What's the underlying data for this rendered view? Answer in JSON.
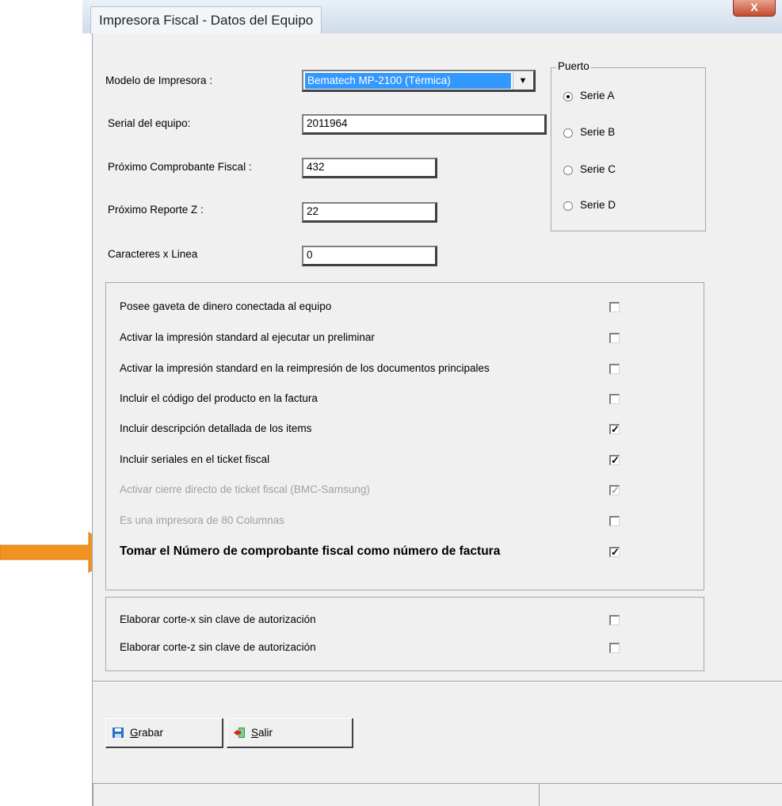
{
  "window": {
    "title": "Impresora Fiscal - Datos del Equipo",
    "close_label": "X"
  },
  "form": {
    "modelo_label": "Modelo  de Impresora :",
    "modelo_value": "Bematech MP-2100 (Térmica)",
    "serial_label": "Serial del equipo:",
    "serial_value": "2011964",
    "comprobante_label": "Próximo Comprobante Fiscal :",
    "comprobante_value": "432",
    "reporte_label": "Próximo Reporte Z :",
    "reporte_value": "22",
    "caracteres_label": "Caracteres x Linea",
    "caracteres_value": "0"
  },
  "puerto": {
    "legend": "Puerto",
    "options": [
      {
        "label": "Serie A",
        "selected": true
      },
      {
        "label": "Serie B",
        "selected": false
      },
      {
        "label": "Serie C",
        "selected": false
      },
      {
        "label": "Serie D",
        "selected": false
      }
    ]
  },
  "options": [
    {
      "label": "Posee gaveta de dinero conectada al equipo",
      "checked": false,
      "disabled": false
    },
    {
      "label": "Activar la impresión standard al ejecutar un preliminar",
      "checked": false,
      "disabled": false
    },
    {
      "label": "Activar la impresión standard en la reimpresión de los documentos principales",
      "checked": false,
      "disabled": false
    },
    {
      "label": "Incluir el código del producto en la factura",
      "checked": false,
      "disabled": false
    },
    {
      "label": "Incluir  descripción detallada de los items",
      "checked": true,
      "disabled": false
    },
    {
      "label": "Incluir seriales en el ticket fiscal",
      "checked": true,
      "disabled": false
    },
    {
      "label": "Activar cierre directo de ticket fiscal  (BMC-Samsung)",
      "checked": true,
      "disabled": true
    },
    {
      "label": "Es una impresora de 80 Columnas",
      "checked": false,
      "disabled": true
    },
    {
      "label": "Tomar el Número de comprobante fiscal como número de factura",
      "checked": true,
      "disabled": false
    }
  ],
  "corte": [
    {
      "label": "Elaborar corte-x sin clave de autorización",
      "checked": false
    },
    {
      "label": "Elaborar corte-z sin clave de autorización",
      "checked": false
    }
  ],
  "buttons": {
    "grabar_mnemonic": "G",
    "grabar_rest": "rabar",
    "salir_mnemonic": "S",
    "salir_rest": "alir"
  },
  "colors": {
    "accent_arrow": "#f0941f",
    "selection": "#3399ff"
  }
}
